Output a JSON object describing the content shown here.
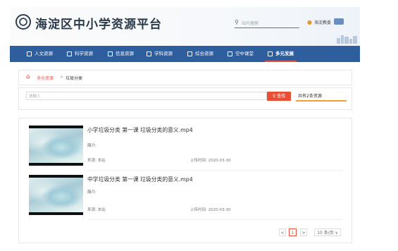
{
  "header": {
    "site_title": "海淀区中小学资源平台",
    "search_placeholder": "站内搜索",
    "user_label": "海淀教委"
  },
  "nav": {
    "items": [
      {
        "label": "人文资源",
        "icon": "book-icon"
      },
      {
        "label": "科学资源",
        "icon": "flask-icon"
      },
      {
        "label": "信息资源",
        "icon": "bars-icon"
      },
      {
        "label": "学科资源",
        "icon": "grad-icon"
      },
      {
        "label": "综合资源",
        "icon": "compass-icon"
      },
      {
        "label": "空中课堂",
        "icon": "cloud-icon"
      },
      {
        "label": "多元发展",
        "icon": "person-icon",
        "active": true
      }
    ]
  },
  "breadcrumb": {
    "home_icon": "home-icon",
    "level1": "多元资源",
    "separator": ">",
    "level2": "垃圾分类"
  },
  "search": {
    "placeholder": "选输入",
    "button_label": "查找",
    "result_count": "共有2条资源"
  },
  "resources": [
    {
      "title": "小学垃圾分类 第一课 垃圾分类的意义.mp4",
      "intro_label": "简介:",
      "source": "来源: 本站",
      "upload_time": "上传时间: 2020-03-30"
    },
    {
      "title": "中学垃圾分类 第一课 垃圾分类的意义.mp4",
      "intro_label": "简介:",
      "source": "来源: 本站",
      "upload_time": "上传时间: 2020-03-30"
    }
  ],
  "pagination": {
    "prev": "<",
    "current_page": "1",
    "next": ">",
    "per_page": "10 条/页 ∨"
  },
  "colors": {
    "nav_bg": "#2f5e9e",
    "accent_red": "#e94f35",
    "accent_orange": "#f0a030"
  }
}
